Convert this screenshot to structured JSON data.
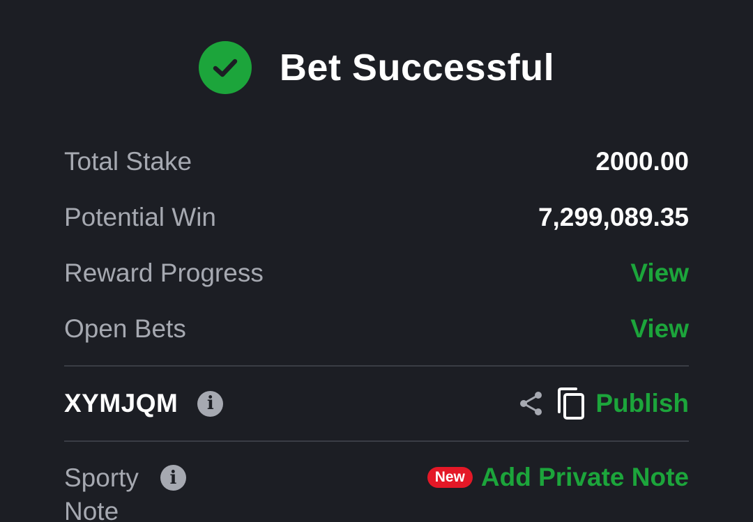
{
  "header": {
    "title": "Bet Successful",
    "icon": "check-circle-icon",
    "icon_color": "#1ca53b"
  },
  "summary": {
    "total_stake_label": "Total Stake",
    "total_stake_value": "2000.00",
    "potential_win_label": "Potential Win",
    "potential_win_value": "7,299,089.35",
    "reward_progress_label": "Reward Progress",
    "reward_progress_link": "View",
    "open_bets_label": "Open Bets",
    "open_bets_link": "View"
  },
  "booking": {
    "code": "XYMJQM",
    "info_icon": "i",
    "share_icon": "share-icon",
    "copy_icon": "copy-icon",
    "publish_label": "Publish"
  },
  "note": {
    "label": "Sporty Note",
    "info_icon": "i",
    "badge": "New",
    "add_label": "Add Private Note"
  },
  "colors": {
    "background": "#1c1e24",
    "accent_green": "#1ca53b",
    "badge_red": "#e41827",
    "muted_text": "#a6a9b1"
  }
}
